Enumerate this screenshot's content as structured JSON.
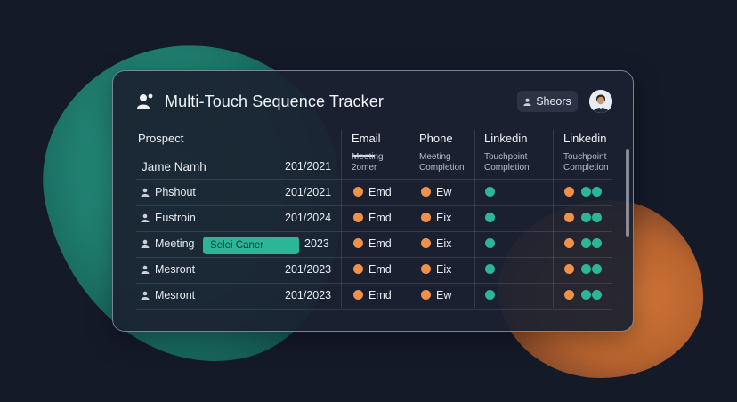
{
  "header": {
    "title": "Multi-Touch Sequence Tracker",
    "share_label": "Sheors",
    "title_icon": "users-icon",
    "avatar_icon": "user-avatar"
  },
  "columns": {
    "prospect": "Prospect",
    "email": "Email",
    "phone": "Phone",
    "linkedin1": "Linkedin",
    "linkedin2": "Linkedin"
  },
  "subheaders": {
    "email": [
      "Meeting",
      "2omer"
    ],
    "phone": [
      "Meeting",
      "Completion"
    ],
    "linkedin1": [
      "Touchpoint",
      "Completion"
    ],
    "linkedin2": [
      "Touchpoint",
      "Completion"
    ]
  },
  "first_row": {
    "name": "Jame Namh",
    "date": "201/2021"
  },
  "rows": [
    {
      "name": "Phshout",
      "date": "201/2021",
      "email": "Emd",
      "phone": "Ew"
    },
    {
      "name": "Eustroin",
      "date": "201/2024",
      "email": "Emd",
      "phone": "Eix"
    },
    {
      "name": "Meeting",
      "date": "2023",
      "email": "Emd",
      "phone": "Eix",
      "tag": "Selei Caner"
    },
    {
      "name": "Mesront",
      "date": "201/2023",
      "email": "Emd",
      "phone": "Eix"
    },
    {
      "name": "Mesront",
      "date": "201/2023",
      "email": "Emd",
      "phone": "Ew"
    }
  ],
  "colors": {
    "orange": "#f0914a",
    "teal": "#2bb797",
    "panel": "#1b2130",
    "background": "#151a29"
  }
}
